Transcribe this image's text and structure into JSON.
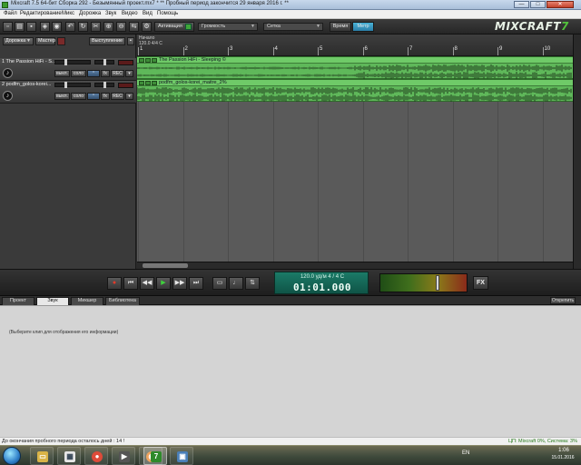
{
  "window": {
    "title": "Mixcraft 7.5 64-бит Сборка 292 - Безымянный проект.mx7 * ** Пробный период закончится 29 января 2016 г. **",
    "min_label": "—",
    "max_label": "□",
    "close_label": "✕"
  },
  "menu": [
    {
      "label": "Файл"
    },
    {
      "label": "Редактирование"
    },
    {
      "label": "Микс"
    },
    {
      "label": "Дорожка"
    },
    {
      "label": "Звук"
    },
    {
      "label": "Видео"
    },
    {
      "label": "Вид"
    },
    {
      "label": "Помощь"
    }
  ],
  "toolbar": {
    "activation_label": "Активация",
    "volume_drop": "Громкость",
    "grid_drop": "Сетка",
    "time_label": "Время",
    "meter_label": "Метр",
    "logo_text": "MIXCRAFT",
    "logo_version": "7"
  },
  "tracks_header": {
    "add_track": "Дорожка",
    "master": "Мастер",
    "performance": "Выступление"
  },
  "tracks": [
    {
      "name": "1 The Passion HiFi - S...",
      "clip_name": "The Passion HiFi - Sleeping ©",
      "buttons": [
        "выкл.",
        "соло",
        "",
        "fx",
        "REC"
      ]
    },
    {
      "name": "2 podfm_golos-korei...",
      "clip_name": "podfm_golos-korei_maitre_2%",
      "buttons": [
        "выкл.",
        "соло",
        "",
        "fx",
        "REC"
      ]
    }
  ],
  "ruler": {
    "tempo_line1": "Начало",
    "tempo_line2": "120.0 4/4 C",
    "bars": [
      "1",
      "2",
      "3",
      "4",
      "5",
      "6",
      "7",
      "8",
      "9",
      "10"
    ]
  },
  "transport": {
    "lcd_top": "120.0 уд/м  4 / 4   C",
    "lcd_time": "01:01.000",
    "fx_label": "FX",
    "master_level": 0.67
  },
  "bottom_tabs": [
    {
      "label": "Проект",
      "active": false
    },
    {
      "label": "Звук",
      "active": true
    },
    {
      "label": "Микшер",
      "active": false
    },
    {
      "label": "Библиотека",
      "active": false
    }
  ],
  "undock_label": "Открепить",
  "panel_hint": "(Выберите клип для отображения его информации)",
  "status": {
    "left": "До окончания пробного периода осталось дней : 14 !",
    "right": "ЦП: Mixcraft 0%, Система: 3%"
  },
  "taskbar": {
    "lang": "EN",
    "time": "1:06",
    "date": "15.01.2016"
  },
  "colors": {
    "accent": "#52c23c",
    "clip": "#5fb85a",
    "lcd": "#1b7a67"
  }
}
